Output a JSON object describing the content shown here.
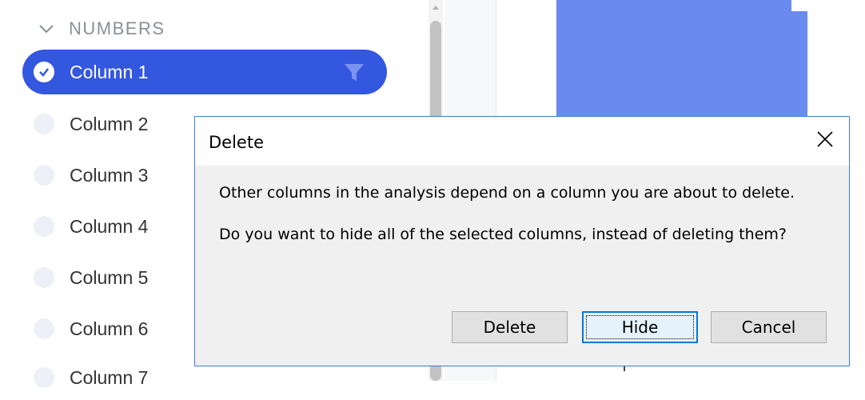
{
  "sidebar": {
    "section_title": "NUMBERS",
    "columns": [
      {
        "label": "Column 1",
        "selected": true
      },
      {
        "label": "Column 2",
        "selected": false
      },
      {
        "label": "Column 3",
        "selected": false
      },
      {
        "label": "Column 4",
        "selected": false
      },
      {
        "label": "Column 5",
        "selected": false
      },
      {
        "label": "Column 6",
        "selected": false
      },
      {
        "label": "Column 7",
        "selected": false
      }
    ]
  },
  "dialog": {
    "title": "Delete",
    "message_1": "Other columns in the analysis depend on a column you are about to delete.",
    "message_2": "Do you want to hide all of the selected columns, instead of deleting them?",
    "buttons": {
      "delete": "Delete",
      "hide": "Hide",
      "cancel": "Cancel"
    }
  },
  "colors": {
    "accent": "#3457e0",
    "bar": "#6a8af0",
    "dialog_border": "#3d7dd6"
  }
}
